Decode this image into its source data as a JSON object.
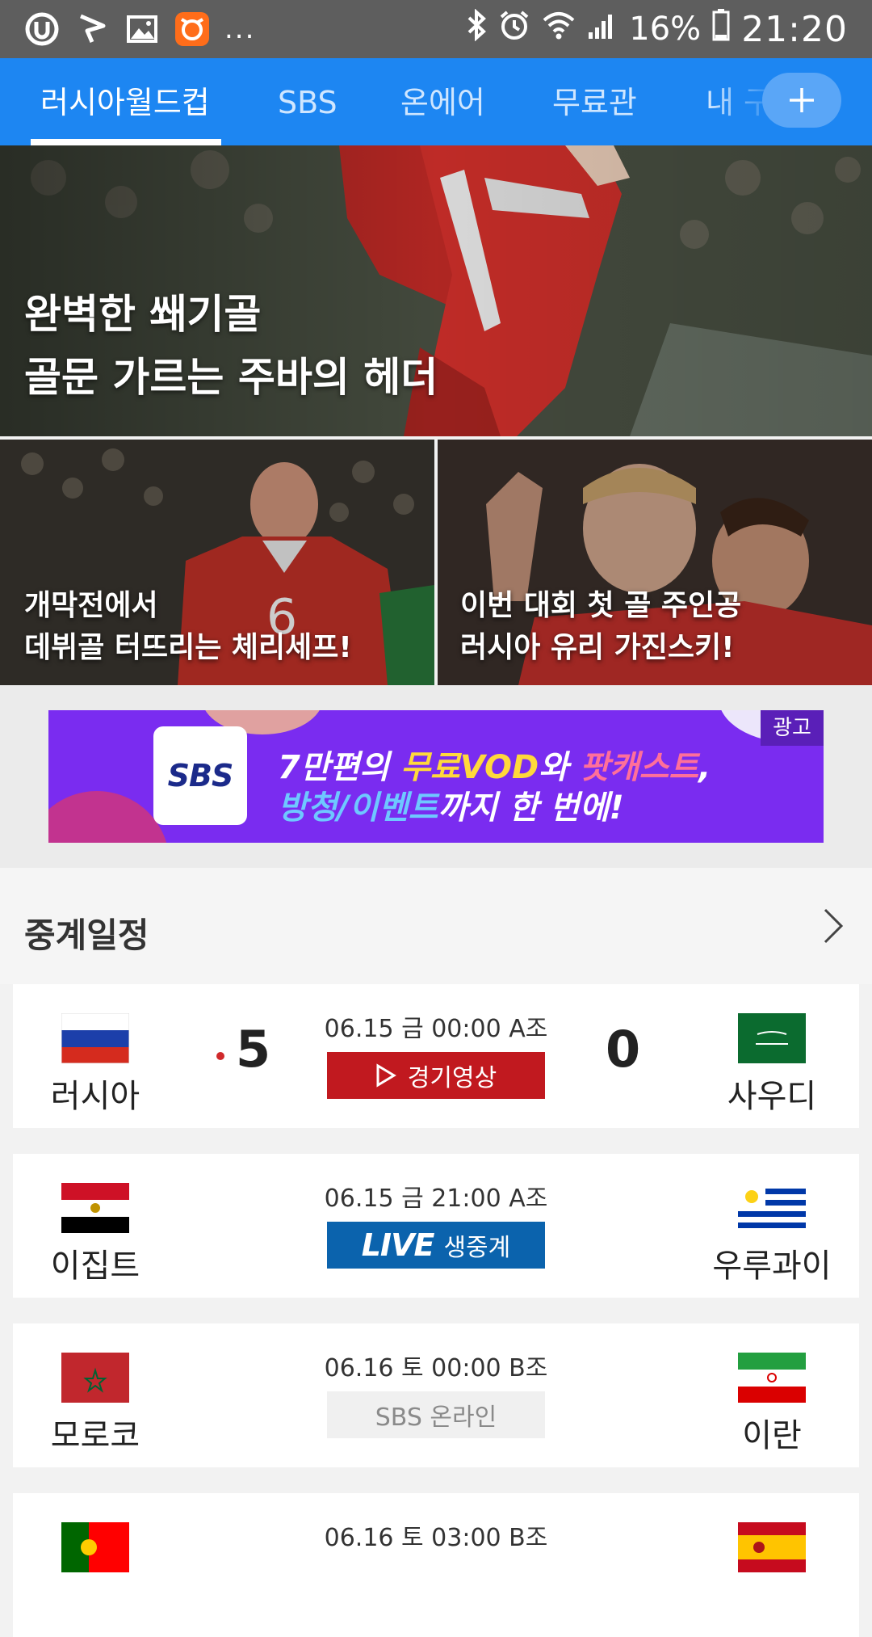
{
  "status_bar": {
    "battery": "16%",
    "time": "21:20",
    "overflow": "..."
  },
  "tabs": [
    {
      "label": "러시아월드컵",
      "active": true
    },
    {
      "label": "SBS"
    },
    {
      "label": "온에어"
    },
    {
      "label": "무료관"
    },
    {
      "label": "내 구"
    }
  ],
  "hero": {
    "title_line1": "완벽한 쐐기골",
    "title_line2": "골문 가르는 주바의 헤더"
  },
  "tiles": [
    {
      "line1": "개막전에서",
      "line2": "데뷔골 터뜨리는 체리세프!"
    },
    {
      "line1": "이번 대회 첫 골 주인공",
      "line2": "러시아 유리 가진스키!"
    }
  ],
  "ad": {
    "logo": "SBS",
    "line1_a": "7만편의 ",
    "line1_b": "무료VOD",
    "line1_c": "와 ",
    "line1_d": "팟캐스트",
    "line1_e": ",",
    "line2_a": "방청/이벤트",
    "line2_b": "까지 한 번에!",
    "badge": "광고"
  },
  "schedule": {
    "title": "중계일정",
    "matches": [
      {
        "home": "러시아",
        "away": "사우디",
        "home_score": "5",
        "away_score": "0",
        "time": "06.15 금 00:00 A조",
        "button": "경기영상",
        "button_type": "replay"
      },
      {
        "home": "이집트",
        "away": "우루과이",
        "time": "06.15 금 21:00 A조",
        "live_mark": "LIVE",
        "button": "생중계",
        "button_type": "live"
      },
      {
        "home": "모로코",
        "away": "이란",
        "time": "06.16 토 00:00 B조",
        "button": "SBS 온라인",
        "button_type": "online"
      },
      {
        "home": "포르투갈",
        "away": "스페인",
        "time": "06.16 토 03:00 B조"
      }
    ]
  },
  "colors": {
    "accent": "#1d86f2",
    "live_blue": "#0b63ad",
    "replay_red": "#c1191f",
    "ad_purple": "#7a2cf0"
  }
}
